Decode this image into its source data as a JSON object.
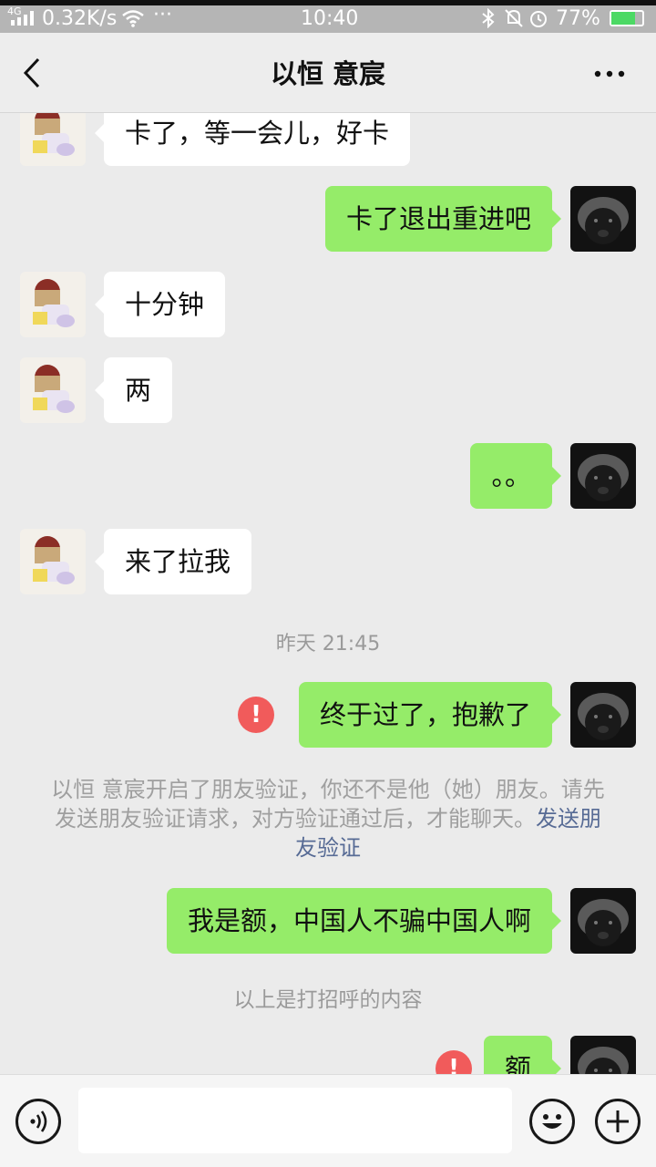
{
  "status_bar": {
    "network_type": "4G",
    "speed": "0.32K/s",
    "more": "···",
    "time": "10:40",
    "battery_percent": "77%",
    "battery_level": 0.77
  },
  "header": {
    "title": "以恒 意宸",
    "back_icon": "chevron-left-icon",
    "more_icon": "more-dots-icon"
  },
  "colors": {
    "incoming_bubble": "#ffffff",
    "outgoing_bubble": "#95ec69",
    "error": "#f15b5b",
    "link": "#576b95",
    "background": "#ebebeb"
  },
  "messages": [
    {
      "side": "left",
      "text": "卡了，等一会儿，好卡"
    },
    {
      "side": "right",
      "text": "卡了退出重进吧"
    },
    {
      "side": "left",
      "text": "十分钟"
    },
    {
      "side": "left",
      "text": "两"
    },
    {
      "side": "right",
      "text": "。。"
    },
    {
      "side": "left",
      "text": "来了拉我"
    },
    {
      "type": "timestamp",
      "text": "昨天 21:45"
    },
    {
      "side": "right",
      "text": "终于过了，抱歉了",
      "failed": true
    },
    {
      "type": "notice",
      "text": "以恒 意宸开启了朋友验证，你还不是他（她）朋友。请先发送朋友验证请求，对方验证通过后，才能聊天。",
      "link_text": "发送朋友验证"
    },
    {
      "side": "right",
      "text": "我是额，中国人不骗中国人啊"
    },
    {
      "type": "system",
      "text": "以上是打招呼的内容"
    },
    {
      "side": "right",
      "text": "额",
      "failed": true
    }
  ],
  "input_bar": {
    "voice_icon": "voice-icon",
    "emoji_icon": "emoji-icon",
    "plus_icon": "plus-icon",
    "text_value": ""
  }
}
